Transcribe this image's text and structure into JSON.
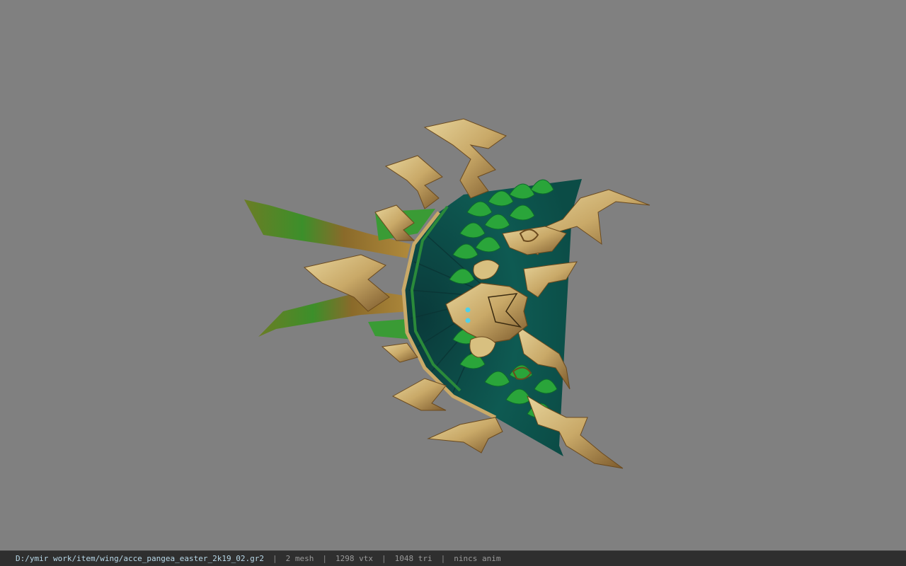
{
  "viewer": {
    "background_color": "#808080",
    "model_subject": "wing accessory 3D model (gold ornament with green feather fan)"
  },
  "status_bar": {
    "file_path": "D:/ymir work/item/wing/acce_pangea_easter_2k19_02.gr2",
    "separator": "|",
    "mesh_count": "2 mesh",
    "vertex_count": "1298 vtx",
    "triangle_count": "1048 tri",
    "anim_status": "nincs anim"
  },
  "colors": {
    "gold": "#c9a968",
    "gold_dark": "#8a6a38",
    "green_bright": "#3fb43f",
    "green_dark": "#0f5a4a",
    "teal": "#0c4e4c",
    "statusbar_bg": "#2f2f2f",
    "path_text": "#b8d8e8"
  }
}
